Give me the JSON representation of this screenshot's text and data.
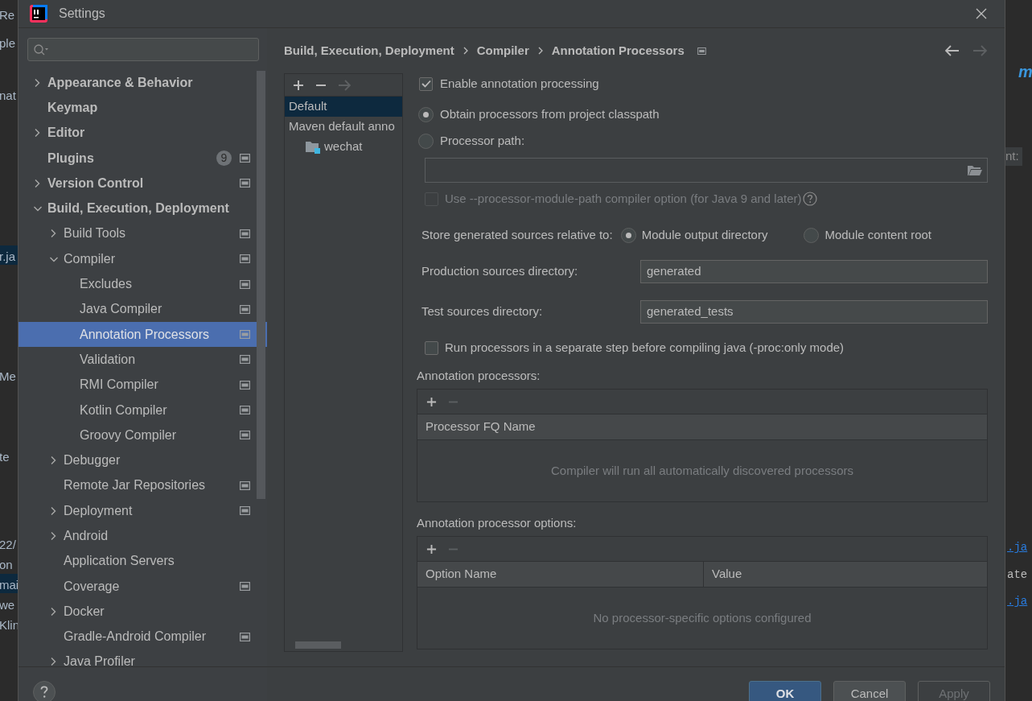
{
  "background_window": {
    "left_fragments": [
      {
        "text": "Re"
      },
      {
        "text": "ple"
      },
      {
        "text": "nat"
      },
      {
        "text": "r.ja"
      },
      {
        "text": "Me"
      },
      {
        "text": "te"
      },
      {
        "text": "22/"
      },
      {
        "text": "on"
      },
      {
        "text": "mai"
      },
      {
        "text": "we"
      },
      {
        "text": "Klin"
      }
    ],
    "right_fragments": [
      {
        "text": "m",
        "kind": "title"
      },
      {
        "text": "nt:",
        "kind": "hint"
      },
      {
        "text": ".ja",
        "kind": "link"
      },
      {
        "text": "ate",
        "kind": "code"
      },
      {
        "text": ".ja",
        "kind": "link"
      }
    ]
  },
  "window": {
    "title": "Settings"
  },
  "sidebar": {
    "items": [
      {
        "label": "Appearance & Behavior",
        "kind": "group",
        "expanded": false,
        "selected": false
      },
      {
        "label": "Keymap",
        "kind": "leaf",
        "selected": false
      },
      {
        "label": "Editor",
        "kind": "group",
        "expanded": false,
        "selected": false
      },
      {
        "label": "Plugins",
        "kind": "leaf",
        "selected": false,
        "badge": "9",
        "project_level": true
      },
      {
        "label": "Version Control",
        "kind": "group",
        "expanded": false,
        "selected": false,
        "project_level": true
      },
      {
        "label": "Build, Execution, Deployment",
        "kind": "group",
        "expanded": true,
        "selected": false,
        "children": [
          {
            "label": "Build Tools",
            "kind": "group",
            "expanded": false,
            "selected": false,
            "project_level": true
          },
          {
            "label": "Compiler",
            "kind": "group",
            "expanded": true,
            "selected": false,
            "project_level": true,
            "children": [
              {
                "label": "Excludes",
                "kind": "leaf",
                "selected": false,
                "project_level": true
              },
              {
                "label": "Java Compiler",
                "kind": "leaf",
                "selected": false,
                "project_level": true
              },
              {
                "label": "Annotation Processors",
                "kind": "leaf",
                "selected": true,
                "project_level": true
              },
              {
                "label": "Validation",
                "kind": "leaf",
                "selected": false,
                "project_level": true
              },
              {
                "label": "RMI Compiler",
                "kind": "leaf",
                "selected": false,
                "project_level": true
              },
              {
                "label": "Kotlin Compiler",
                "kind": "leaf",
                "selected": false,
                "project_level": true
              },
              {
                "label": "Groovy Compiler",
                "kind": "leaf",
                "selected": false,
                "project_level": true
              }
            ]
          },
          {
            "label": "Debugger",
            "kind": "group",
            "expanded": false,
            "selected": false
          },
          {
            "label": "Remote Jar Repositories",
            "kind": "leaf",
            "selected": false,
            "project_level": true
          },
          {
            "label": "Deployment",
            "kind": "group",
            "expanded": false,
            "selected": false,
            "project_level": true
          },
          {
            "label": "Android",
            "kind": "group",
            "expanded": false,
            "selected": false
          },
          {
            "label": "Application Servers",
            "kind": "leaf",
            "selected": false
          },
          {
            "label": "Coverage",
            "kind": "leaf",
            "selected": false,
            "project_level": true
          },
          {
            "label": "Docker",
            "kind": "group",
            "expanded": false,
            "selected": false
          },
          {
            "label": "Gradle-Android Compiler",
            "kind": "leaf",
            "selected": false,
            "project_level": true
          },
          {
            "label": "Java Profiler",
            "kind": "group",
            "expanded": false,
            "selected": false
          }
        ]
      }
    ]
  },
  "breadcrumb": [
    "Build, Execution, Deployment",
    "Compiler",
    "Annotation Processors"
  ],
  "navigation": {
    "back_disabled": false,
    "forward_disabled": true
  },
  "profiles": {
    "items": [
      {
        "label": "Default",
        "selected": true
      },
      {
        "label": "Maven default anno",
        "selected": false,
        "children": [
          {
            "label": "wechat",
            "selected": false
          }
        ]
      }
    ]
  },
  "form": {
    "enable_processing": {
      "label": "Enable annotation processing",
      "checked": true
    },
    "processor_source": [
      {
        "label": "Obtain processors from project classpath",
        "selected": true
      },
      {
        "label": "Processor path:",
        "selected": false
      }
    ],
    "module_path_option": {
      "label": "Use --processor-module-path compiler option (for Java 9 and later)",
      "checked": false,
      "disabled": true
    },
    "store_relative": {
      "label": "Store generated sources relative to:",
      "options": [
        {
          "label": "Module output directory",
          "selected": true
        },
        {
          "label": "Module content root",
          "selected": false
        }
      ]
    },
    "production_dir": {
      "label": "Production sources directory:",
      "value": "generated"
    },
    "test_dir": {
      "label": "Test sources directory:",
      "value": "generated_tests"
    },
    "separate_step": {
      "label": "Run processors in a separate step before compiling java (-proc:only mode)",
      "checked": false
    },
    "processors_table": {
      "title": "Annotation processors:",
      "columns": [
        "Processor FQ Name"
      ],
      "empty_text": "Compiler will run all automatically discovered processors"
    },
    "options_table": {
      "title": "Annotation processor options:",
      "columns": [
        "Option Name",
        "Value"
      ],
      "empty_text": "No processor-specific options configured"
    }
  },
  "buttons": [
    {
      "label": "OK",
      "kind": "primary",
      "disabled": false
    },
    {
      "label": "Cancel",
      "kind": "normal",
      "disabled": false
    },
    {
      "label": "Apply",
      "kind": "normal",
      "disabled": true
    }
  ]
}
